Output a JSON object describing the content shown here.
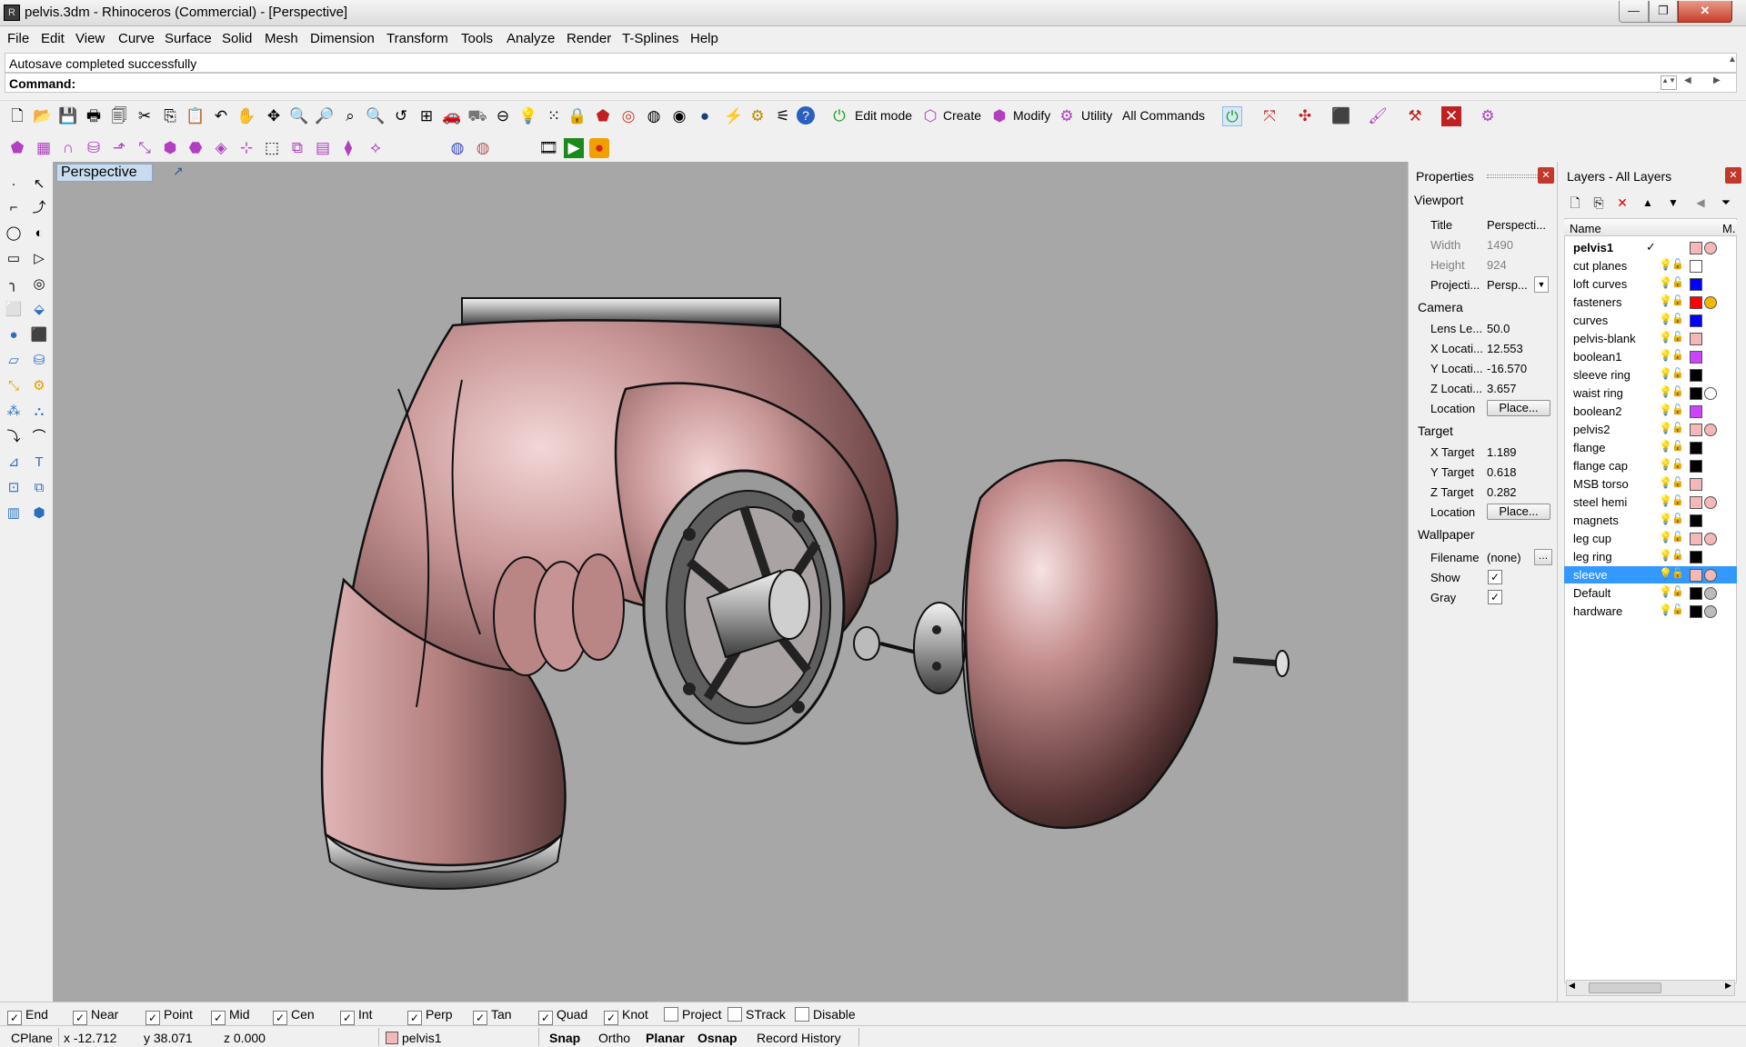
{
  "window": {
    "title": "pelvis.3dm - Rhinoceros (Commercial) - [Perspective]",
    "minimize": "—",
    "maximize": "❐",
    "close": "✕"
  },
  "menu": [
    "File",
    "Edit",
    "View",
    "Curve",
    "Surface",
    "Solid",
    "Mesh",
    "Dimension",
    "Transform",
    "Tools",
    "Analyze",
    "Render",
    "T-Splines",
    "Help"
  ],
  "command": {
    "history": "Autosave completed successfully",
    "prompt": "Command:"
  },
  "toolbar": {
    "edit_mode": "Edit mode",
    "create": "Create",
    "modify": "Modify",
    "utility": "Utility",
    "all_commands": "All Commands"
  },
  "viewport": {
    "tab": "Perspective"
  },
  "properties": {
    "title": "Properties",
    "viewport_header": "Viewport",
    "title_label": "Title",
    "title_value": "Perspecti...",
    "width_label": "Width",
    "width_value": "1490",
    "height_label": "Height",
    "height_value": "924",
    "projection_label": "Projecti...",
    "projection_value": "Persp...",
    "camera_header": "Camera",
    "lens_label": "Lens Le...",
    "lens_value": "50.0",
    "xloc_label": "X Locati...",
    "xloc_value": "12.553",
    "yloc_label": "Y Locati...",
    "yloc_value": "-16.570",
    "zloc_label": "Z Locati...",
    "zloc_value": "3.657",
    "cam_location_label": "Location",
    "cam_location_btn": "Place...",
    "target_header": "Target",
    "xtarget_label": "X Target",
    "xtarget_value": "1.189",
    "ytarget_label": "Y Target",
    "ytarget_value": "0.618",
    "ztarget_label": "Z Target",
    "ztarget_value": "0.282",
    "target_location_label": "Location",
    "target_location_btn": "Place...",
    "wallpaper_header": "Wallpaper",
    "filename_label": "Filename",
    "filename_value": "(none)",
    "show_label": "Show",
    "gray_label": "Gray"
  },
  "layers": {
    "title": "Layers - All Layers",
    "col_name": "Name",
    "col_mat": "M.",
    "items": [
      {
        "name": "pelvis1",
        "color": "#f4b8b8",
        "material": "#f4b8b8",
        "current": true,
        "selected": false,
        "bulb": "#2a6fd6"
      },
      {
        "name": "cut planes",
        "color": "#ffffff",
        "material": "",
        "current": false,
        "selected": false,
        "bulb": "#2a6fd6"
      },
      {
        "name": "loft curves",
        "color": "#0000ff",
        "material": "",
        "current": false,
        "selected": false,
        "bulb": "#2a6fd6"
      },
      {
        "name": "fasteners",
        "color": "#ff0000",
        "material": "#f2b800",
        "current": false,
        "selected": false,
        "bulb": "#2a6fd6"
      },
      {
        "name": "curves",
        "color": "#0000ff",
        "material": "",
        "current": false,
        "selected": false,
        "bulb": "#2a6fd6"
      },
      {
        "name": "pelvis-blank",
        "color": "#f4b8b8",
        "material": "",
        "current": false,
        "selected": false,
        "bulb": "#2a6fd6"
      },
      {
        "name": "boolean1",
        "color": "#cc44ff",
        "material": "",
        "current": false,
        "selected": false,
        "bulb": "#2a6fd6"
      },
      {
        "name": "sleeve ring",
        "color": "#000000",
        "material": "",
        "current": false,
        "selected": false,
        "bulb": "#2a6fd6"
      },
      {
        "name": "waist ring",
        "color": "#000000",
        "material": "#ffffff",
        "current": false,
        "selected": false,
        "bulb": "#e8d23a"
      },
      {
        "name": "boolean2",
        "color": "#cc44ff",
        "material": "",
        "current": false,
        "selected": false,
        "bulb": "#2a6fd6"
      },
      {
        "name": "pelvis2",
        "color": "#f4b8b8",
        "material": "#f4b8b8",
        "current": false,
        "selected": false,
        "bulb": "#2a6fd6"
      },
      {
        "name": "flange",
        "color": "#000000",
        "material": "",
        "current": false,
        "selected": false,
        "bulb": "#e8d23a"
      },
      {
        "name": "flange cap",
        "color": "#000000",
        "material": "",
        "current": false,
        "selected": false,
        "bulb": "#e8d23a"
      },
      {
        "name": "MSB torso",
        "color": "#f4b8b8",
        "material": "",
        "current": false,
        "selected": false,
        "bulb": "#2a6fd6"
      },
      {
        "name": "steel hemi",
        "color": "#f4b8b8",
        "material": "#f4b8b8",
        "current": false,
        "selected": false,
        "bulb": "#2a6fd6"
      },
      {
        "name": "magnets",
        "color": "#000000",
        "material": "",
        "current": false,
        "selected": false,
        "bulb": "#2a6fd6"
      },
      {
        "name": "leg cup",
        "color": "#f4b8b8",
        "material": "#f4b8b8",
        "current": false,
        "selected": false,
        "bulb": "#e8d23a"
      },
      {
        "name": "leg ring",
        "color": "#000000",
        "material": "",
        "current": false,
        "selected": false,
        "bulb": "#e8d23a"
      },
      {
        "name": "sleeve",
        "color": "#f4b8b8",
        "material": "#f4b8b8",
        "current": false,
        "selected": true,
        "bulb": "#ffffff"
      },
      {
        "name": "Default",
        "color": "#000000",
        "material": "#bbbbbb",
        "current": false,
        "selected": false,
        "bulb": "#e8d23a"
      },
      {
        "name": "hardware",
        "color": "#000000",
        "material": "#bbbbbb",
        "current": false,
        "selected": false,
        "bulb": "#e8d23a"
      }
    ]
  },
  "osnap": [
    {
      "label": "End",
      "checked": true
    },
    {
      "label": "Near",
      "checked": true
    },
    {
      "label": "Point",
      "checked": true
    },
    {
      "label": "Mid",
      "checked": true
    },
    {
      "label": "Cen",
      "checked": true
    },
    {
      "label": "Int",
      "checked": true
    },
    {
      "label": "Perp",
      "checked": true
    },
    {
      "label": "Tan",
      "checked": true
    },
    {
      "label": "Quad",
      "checked": true
    },
    {
      "label": "Knot",
      "checked": true
    },
    {
      "label": "Project",
      "checked": false
    },
    {
      "label": "STrack",
      "checked": false
    },
    {
      "label": "Disable",
      "checked": false
    }
  ],
  "status": {
    "cplane": "CPlane",
    "x": "x -12.712",
    "y": "y 38.071",
    "z": "z 0.000",
    "layer": "pelvis1",
    "snap": "Snap",
    "ortho": "Ortho",
    "planar": "Planar",
    "osnap": "Osnap",
    "record_history": "Record History"
  },
  "colors": {
    "viewport_bg": "#a7a7a7",
    "model_pink": "#c08a8a",
    "selection": "#3399ff"
  }
}
